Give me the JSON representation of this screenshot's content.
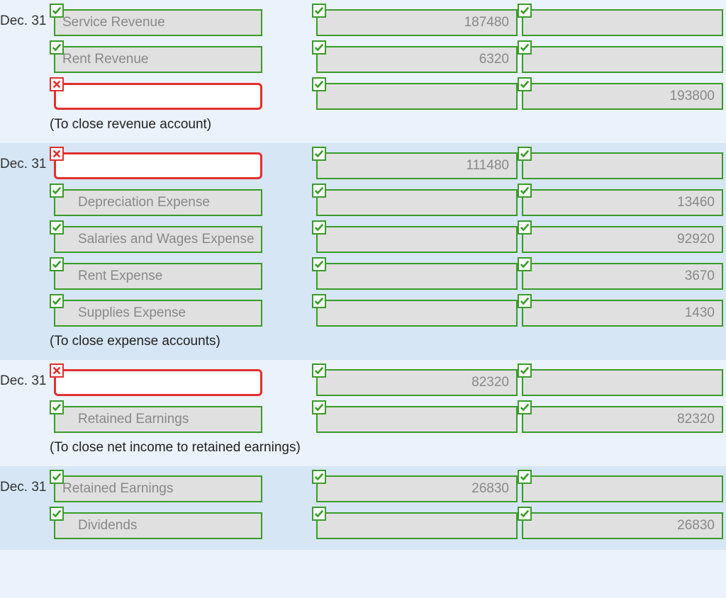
{
  "sections": [
    {
      "alt": false,
      "rows": [
        {
          "date": "Dec. 31",
          "indent": false,
          "account": {
            "value": "Service Revenue",
            "status": "ok"
          },
          "debit": {
            "value": "187480",
            "status": "ok"
          },
          "credit": {
            "value": "",
            "status": "ok"
          }
        },
        {
          "date": "",
          "indent": false,
          "account": {
            "value": "Rent Revenue",
            "status": "ok"
          },
          "debit": {
            "value": "6320",
            "status": "ok"
          },
          "credit": {
            "value": "",
            "status": "ok"
          }
        },
        {
          "date": "",
          "indent": false,
          "account": {
            "value": "",
            "status": "error"
          },
          "debit": {
            "value": "",
            "status": "ok"
          },
          "credit": {
            "value": "193800",
            "status": "ok"
          }
        }
      ],
      "explain": "(To close revenue account)"
    },
    {
      "alt": true,
      "rows": [
        {
          "date": "Dec. 31",
          "indent": false,
          "account": {
            "value": "",
            "status": "error"
          },
          "debit": {
            "value": "111480",
            "status": "ok"
          },
          "credit": {
            "value": "",
            "status": "ok"
          }
        },
        {
          "date": "",
          "indent": true,
          "account": {
            "value": "Depreciation Expense",
            "status": "ok"
          },
          "debit": {
            "value": "",
            "status": "ok"
          },
          "credit": {
            "value": "13460",
            "status": "ok"
          }
        },
        {
          "date": "",
          "indent": true,
          "account": {
            "value": "Salaries and Wages Expense",
            "status": "ok"
          },
          "debit": {
            "value": "",
            "status": "ok"
          },
          "credit": {
            "value": "92920",
            "status": "ok"
          }
        },
        {
          "date": "",
          "indent": true,
          "account": {
            "value": "Rent Expense",
            "status": "ok"
          },
          "debit": {
            "value": "",
            "status": "ok"
          },
          "credit": {
            "value": "3670",
            "status": "ok"
          }
        },
        {
          "date": "",
          "indent": true,
          "account": {
            "value": "Supplies Expense",
            "status": "ok"
          },
          "debit": {
            "value": "",
            "status": "ok"
          },
          "credit": {
            "value": "1430",
            "status": "ok"
          }
        }
      ],
      "explain": "(To close expense accounts)"
    },
    {
      "alt": false,
      "rows": [
        {
          "date": "Dec. 31",
          "indent": false,
          "account": {
            "value": "",
            "status": "error"
          },
          "debit": {
            "value": "82320",
            "status": "ok"
          },
          "credit": {
            "value": "",
            "status": "ok"
          }
        },
        {
          "date": "",
          "indent": true,
          "account": {
            "value": "Retained Earnings",
            "status": "ok"
          },
          "debit": {
            "value": "",
            "status": "ok"
          },
          "credit": {
            "value": "82320",
            "status": "ok"
          }
        }
      ],
      "explain": "(To close net income to retained earnings)"
    },
    {
      "alt": true,
      "rows": [
        {
          "date": "Dec. 31",
          "indent": false,
          "account": {
            "value": "Retained Earnings",
            "status": "ok"
          },
          "debit": {
            "value": "26830",
            "status": "ok"
          },
          "credit": {
            "value": "",
            "status": "ok"
          }
        },
        {
          "date": "",
          "indent": true,
          "account": {
            "value": "Dividends",
            "status": "ok"
          },
          "debit": {
            "value": "",
            "status": "ok"
          },
          "credit": {
            "value": "26830",
            "status": "ok"
          }
        }
      ],
      "explain": ""
    }
  ]
}
